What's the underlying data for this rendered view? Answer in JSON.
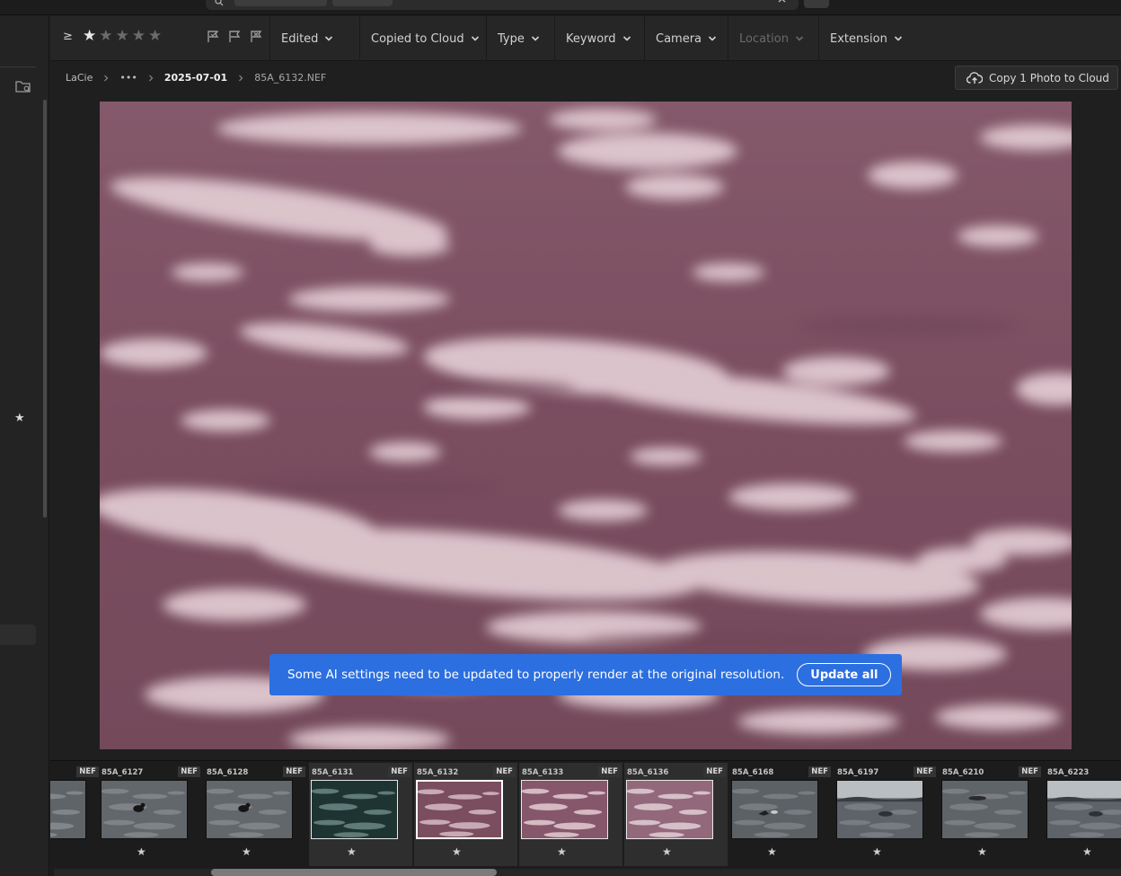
{
  "filter_bar": {
    "min_rating_symbol": "≥",
    "stars": [
      {
        "icon": "star-filled-icon",
        "on": true
      },
      {
        "icon": "star-icon",
        "on": false
      },
      {
        "icon": "star-icon",
        "on": false
      },
      {
        "icon": "star-icon",
        "on": false
      },
      {
        "icon": "star-icon",
        "on": false
      }
    ],
    "flag_icons": [
      "flag-picked-icon",
      "flag-unflagged-icon",
      "flag-rejected-icon"
    ],
    "filters": [
      {
        "label": "Edited",
        "enabled": true
      },
      {
        "label": "Copied to Cloud",
        "enabled": true
      },
      {
        "label": "Type",
        "enabled": true
      },
      {
        "label": "Keyword",
        "enabled": true
      },
      {
        "label": "Camera",
        "enabled": true
      },
      {
        "label": "Location",
        "enabled": false
      },
      {
        "label": "Extension",
        "enabled": true
      }
    ]
  },
  "breadcrumb": {
    "items": [
      "LaCie",
      "•••",
      "2025-07-01",
      "85A_6132.NEF"
    ]
  },
  "cloud_button": {
    "label": "Copy 1 Photo to Cloud",
    "icon": "cloud-upload-icon"
  },
  "left_rail": {
    "folder_icon": "folder-search-icon",
    "star_icon": "star-filled-icon"
  },
  "banner": {
    "message": "Some AI settings need to be updated to properly render at the original resolution.",
    "action_label": "Update all",
    "icons": {
      "warning": "warning-icon",
      "close": "close-icon"
    },
    "color": "#2c6fe0"
  },
  "filmstrip": {
    "thumbnails": [
      {
        "name": "",
        "badge": "NEF",
        "rating": "★",
        "style": "gray-water",
        "selected": false
      },
      {
        "name": "85A_6127",
        "badge": "NEF",
        "rating": "★",
        "style": "gray-bird",
        "selected": false
      },
      {
        "name": "85A_6128",
        "badge": "NEF",
        "rating": "★",
        "style": "gray-bird",
        "selected": false
      },
      {
        "name": "85A_6131",
        "badge": "NEF",
        "rating": "★",
        "style": "dark-teal",
        "selected": true
      },
      {
        "name": "85A_6132",
        "badge": "NEF",
        "rating": "★",
        "style": "magenta",
        "selected": true,
        "current": true
      },
      {
        "name": "85A_6133",
        "badge": "NEF",
        "rating": "★",
        "style": "magenta-light",
        "selected": true
      },
      {
        "name": "85A_6136",
        "badge": "NEF",
        "rating": "★",
        "style": "magenta-pale",
        "selected": true
      },
      {
        "name": "85A_6168",
        "badge": "NEF",
        "rating": "★",
        "style": "gray-whale",
        "selected": false
      },
      {
        "name": "85A_6197",
        "badge": "NEF",
        "rating": "★",
        "style": "gray-coast",
        "selected": false
      },
      {
        "name": "85A_6210",
        "badge": "NEF",
        "rating": "★",
        "style": "gray-whale2",
        "selected": false
      },
      {
        "name": "85A_6223",
        "badge": "N",
        "rating": "★",
        "style": "gray-coast",
        "selected": false
      }
    ]
  }
}
